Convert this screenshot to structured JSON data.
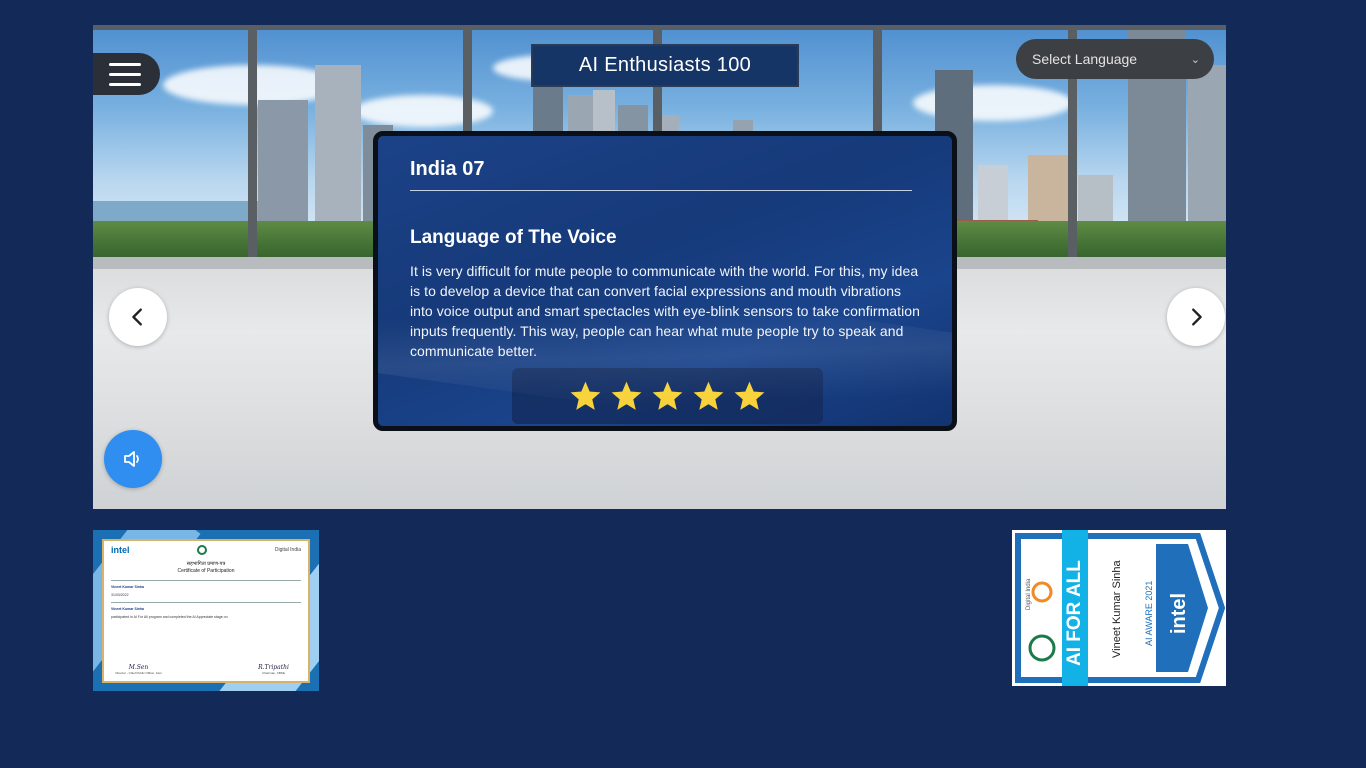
{
  "header": {
    "title": "AI Enthusiasts 100",
    "language_select": {
      "value": "Select Language",
      "chevron_icon": "chevron-down-icon"
    },
    "menu_icon": "hamburger-menu-icon"
  },
  "navigation": {
    "prev_icon": "chevron-left-icon",
    "next_icon": "chevron-right-icon",
    "sound_icon": "speaker-icon"
  },
  "card": {
    "id": "India 07",
    "title": "Language of The Voice",
    "description": "It is very difficult for mute people to communicate with the world. For this, my idea is to develop a device that can convert facial expressions and mouth vibrations into voice output and smart spectacles with eye-blink sensors to take confirmation inputs frequently. This way, people can hear what mute people try to speak and communicate better.",
    "rating": 5,
    "rating_max": 5
  },
  "certificate": {
    "brand": "intel",
    "partner": "Digital India",
    "heading_hindi": "सहभागिता प्रमाण-पत्र",
    "heading": "Certificate of Participation",
    "recipient": "Vineet Kumar Sinha",
    "date": "31/03/2022",
    "body": "participated in AI For All program and completed the AI Appreciate stage on",
    "signature_left": "Director - Chief Public Officer, Intel",
    "signature_right": "Chairman, CBSE"
  },
  "badge": {
    "program": "AI FOR ALL",
    "recipient": "Vineet Kumar Sinha",
    "stage": "AI AWARE 2021",
    "brand": "intel",
    "partner": "Digital India"
  },
  "colors": {
    "background": "#132a58",
    "card": "#1a3f84",
    "accent_blue": "#2f8ef0",
    "star": "#f7d23a",
    "badge_cyan": "#12b2e6",
    "badge_blue": "#1f6fba"
  }
}
